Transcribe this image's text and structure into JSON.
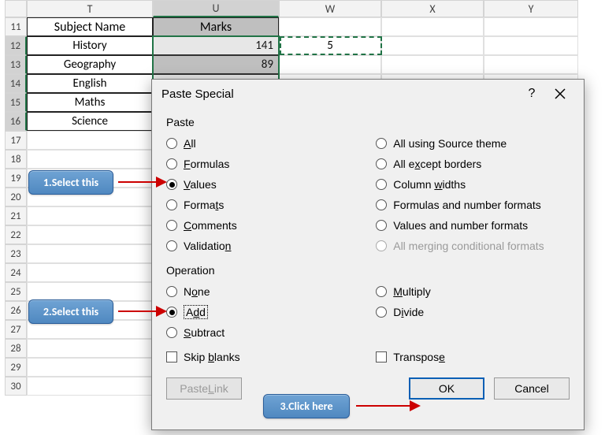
{
  "columns": {
    "T": "T",
    "U": "U",
    "W": "W",
    "X": "X",
    "Y": "Y"
  },
  "rows": [
    "11",
    "12",
    "13",
    "14",
    "15",
    "16",
    "17",
    "18",
    "19",
    "20",
    "21",
    "22",
    "23",
    "24",
    "25",
    "26",
    "27",
    "28",
    "29",
    "30"
  ],
  "header": {
    "subject": "Subject Name",
    "marks": "Marks"
  },
  "table": {
    "r12": {
      "subject": "History",
      "marks": "141"
    },
    "r13": {
      "subject": "Geography",
      "marks": "89"
    },
    "r14": {
      "subject": "English"
    },
    "r15": {
      "subject": "Maths"
    },
    "r16": {
      "subject": "Science"
    }
  },
  "w12": "5",
  "dialog": {
    "title": "Paste Special",
    "help": "?",
    "grp_paste": "Paste",
    "grp_op": "Operation",
    "paste": {
      "all": "All",
      "formulas": "Formulas",
      "values": "Values",
      "formats": "Formats",
      "comments": "Comments",
      "validation": "Validation",
      "allTheme": "All using Source theme",
      "exceptBorders": "All except borders",
      "colWidths": "Column widths",
      "fnum": "Formulas and number formats",
      "vnum": "Values and number formats",
      "mergeCond": "All merging conditional formats"
    },
    "op": {
      "none": "None",
      "add": "Add",
      "sub": "Subtract",
      "mul": "Multiply",
      "div": "Divide"
    },
    "skip": "Skip blanks",
    "transpose": "Transpose",
    "pasteLink": "Paste Link",
    "ok": "OK",
    "cancel": "Cancel"
  },
  "callouts": {
    "c1": "1.Select this",
    "c2": "2.Select this",
    "c3": "3.Click here"
  }
}
